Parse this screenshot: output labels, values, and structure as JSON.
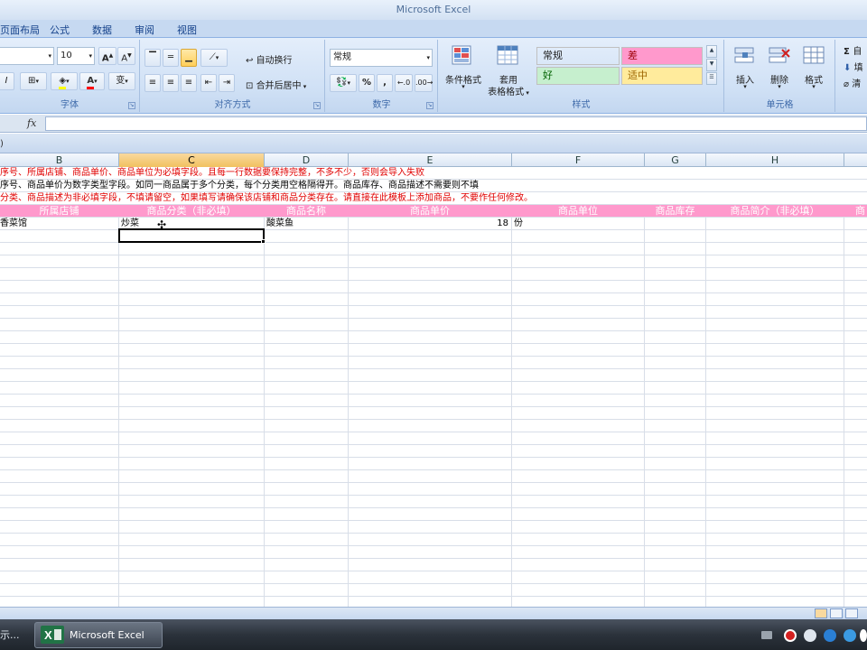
{
  "window": {
    "title": "Microsoft Excel"
  },
  "tabs": [
    "页面布局",
    "公式",
    "数据",
    "审阅",
    "视图"
  ],
  "ribbon": {
    "font_group": {
      "label": "字体",
      "size": "10",
      "phonetic": "变"
    },
    "align_group": {
      "label": "对齐方式",
      "wrap": "自动换行",
      "merge": "合并后居中"
    },
    "number_group": {
      "label": "数字",
      "format": "常规",
      "percent": "%",
      "comma": ","
    },
    "styles_group": {
      "label": "样式",
      "cond_format": "条件格式",
      "table_format": "套用\n表格格式",
      "table_format_line1": "套用",
      "table_format_line2": "表格格式",
      "cells": [
        {
          "text": "常规",
          "bg": "#ffffff",
          "color": "#000000"
        },
        {
          "text": "差",
          "bg": "#ff99cc",
          "color": "#9c0006"
        },
        {
          "text": "好",
          "bg": "#c6efce",
          "color": "#006100"
        },
        {
          "text": "适中",
          "bg": "#ffeb9c",
          "color": "#9c6500"
        }
      ]
    },
    "cells_group": {
      "label": "单元格",
      "insert": "插入",
      "delete": "删除",
      "format": "格式"
    },
    "editing_group": {
      "autosum": "自",
      "fill": "填",
      "clear": "清"
    }
  },
  "formula_bar": {
    "fx": "fx",
    "value": ""
  },
  "name_box_tail": ")",
  "sheet": {
    "columns": [
      "B",
      "C",
      "D",
      "E",
      "F",
      "G",
      "H"
    ],
    "selected_column": "C",
    "notes": [
      "序号、所属店铺、商品单价、商品单位为必填字段。且每一行数据要保持完整，不多不少，否则会导入失败",
      "序号、商品单价为数字类型字段。如同一商品属于多个分类，每个分类用空格隔得开。商品库存、商品描述不需要则不填",
      "分类、商品描述为非必填字段，不填请留空，如果填写请确保该店铺和商品分类存在。请直接在此模板上添加商品，不要作任何修改。"
    ],
    "headers": [
      "所属店铺",
      "商品分类（非必填）",
      "商品名称",
      "商品单价",
      "商品单位",
      "商品库存",
      "商品简介（非必填）",
      "商"
    ],
    "row1": {
      "store": "香菜馆",
      "category": "炒菜",
      "name": "酸菜鱼",
      "price": "18",
      "unit": "份"
    }
  },
  "colors": {
    "header_pink": "#ff99cc",
    "note_red": "#e00000",
    "excel_green": "#217346"
  },
  "taskbar": {
    "left_label": "示...",
    "excel_label": "Microsoft Excel"
  }
}
